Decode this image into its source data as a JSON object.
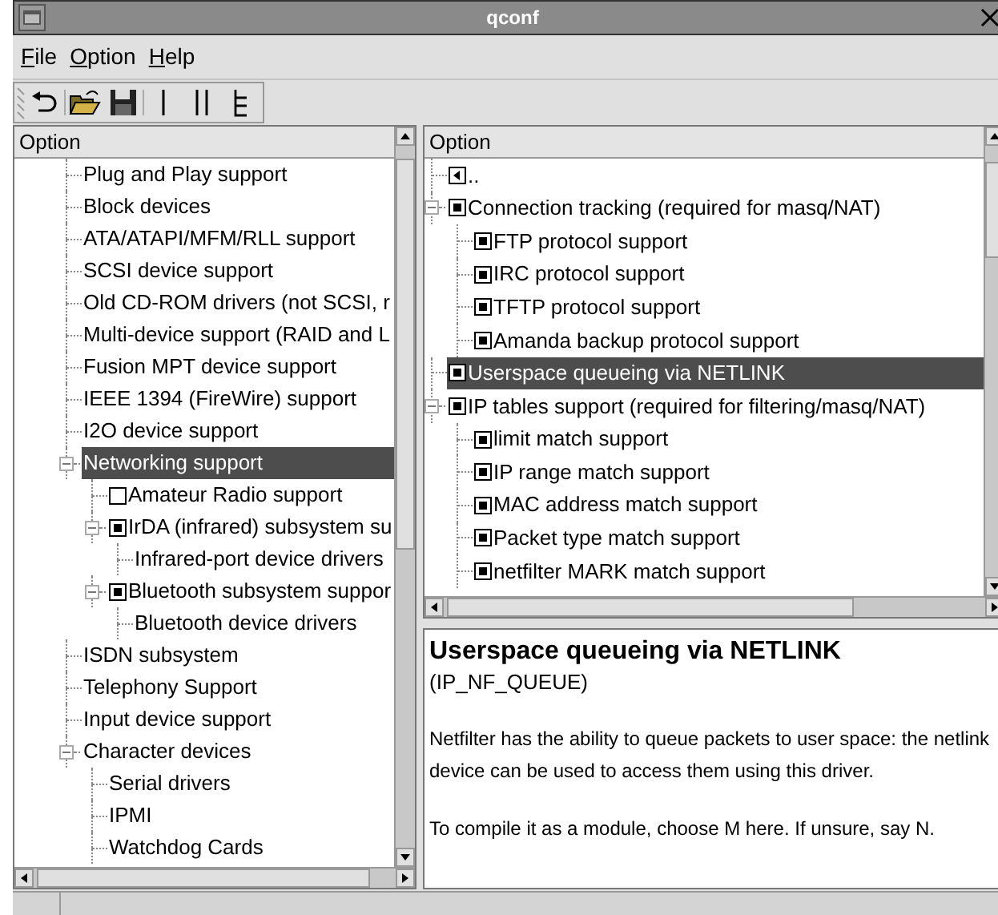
{
  "window": {
    "title": "qconf"
  },
  "menu": [
    {
      "label": "File"
    },
    {
      "label": "Option"
    },
    {
      "label": "Help"
    }
  ],
  "left_tree": {
    "header": "Option",
    "items": [
      {
        "label": "Plug and Play support",
        "kind": "menu",
        "selected": false
      },
      {
        "label": "Block devices",
        "kind": "menu",
        "selected": false
      },
      {
        "label": "ATA/ATAPI/MFM/RLL support",
        "kind": "menu",
        "selected": false
      },
      {
        "label": "SCSI device support",
        "kind": "menu",
        "selected": false
      },
      {
        "label": "Old CD-ROM drivers (not SCSI, r",
        "kind": "menu",
        "selected": false
      },
      {
        "label": "Multi-device support (RAID and L",
        "kind": "menu",
        "selected": false
      },
      {
        "label": "Fusion MPT device support",
        "kind": "menu",
        "selected": false
      },
      {
        "label": "IEEE 1394 (FireWire) support",
        "kind": "menu",
        "selected": false
      },
      {
        "label": "I2O device support",
        "kind": "menu",
        "selected": false
      },
      {
        "label": "Networking support",
        "kind": "menu",
        "selected": true,
        "expanded": true,
        "children": [
          {
            "label": "Amateur Radio support",
            "kind": "checkbox",
            "checked": false,
            "selected": false
          },
          {
            "label": "IrDA (infrared) subsystem su",
            "kind": "checkbox",
            "checked": true,
            "selected": false,
            "expanded": true,
            "children": [
              {
                "label": "Infrared-port device drivers",
                "kind": "menu",
                "selected": false
              }
            ]
          },
          {
            "label": "Bluetooth subsystem suppor",
            "kind": "checkbox",
            "checked": true,
            "selected": false,
            "expanded": true,
            "children": [
              {
                "label": "Bluetooth device drivers",
                "kind": "menu",
                "selected": false
              }
            ]
          }
        ]
      },
      {
        "label": "ISDN subsystem",
        "kind": "menu",
        "selected": false
      },
      {
        "label": "Telephony Support",
        "kind": "menu",
        "selected": false
      },
      {
        "label": "Input device support",
        "kind": "menu",
        "selected": false
      },
      {
        "label": "Character devices",
        "kind": "menu",
        "selected": false,
        "expanded": true,
        "children": [
          {
            "label": "Serial drivers",
            "kind": "menu",
            "selected": false
          },
          {
            "label": "IPMI",
            "kind": "menu",
            "selected": false
          },
          {
            "label": "Watchdog Cards",
            "kind": "menu",
            "selected": false
          }
        ]
      }
    ]
  },
  "right_tree": {
    "header": "Option",
    "items": [
      {
        "label": "..",
        "kind": "back",
        "selected": false
      },
      {
        "label": "Connection tracking (required for masq/NAT)",
        "kind": "checkbox",
        "checked": true,
        "selected": false,
        "expanded": true,
        "children": [
          {
            "label": "FTP protocol support",
            "kind": "checkbox",
            "checked": true,
            "selected": false
          },
          {
            "label": "IRC protocol support",
            "kind": "checkbox",
            "checked": true,
            "selected": false
          },
          {
            "label": "TFTP protocol support",
            "kind": "checkbox",
            "checked": true,
            "selected": false
          },
          {
            "label": "Amanda backup protocol support",
            "kind": "checkbox",
            "checked": true,
            "selected": false
          }
        ]
      },
      {
        "label": "Userspace queueing via NETLINK",
        "kind": "checkbox",
        "checked": true,
        "selected": true
      },
      {
        "label": "IP tables support (required for filtering/masq/NAT)",
        "kind": "checkbox",
        "checked": true,
        "selected": false,
        "expanded": true,
        "children": [
          {
            "label": "limit match support",
            "kind": "checkbox",
            "checked": true,
            "selected": false
          },
          {
            "label": "IP range match support",
            "kind": "checkbox",
            "checked": true,
            "selected": false
          },
          {
            "label": "MAC address match support",
            "kind": "checkbox",
            "checked": true,
            "selected": false
          },
          {
            "label": "Packet type match support",
            "kind": "checkbox",
            "checked": true,
            "selected": false
          },
          {
            "label": "netfilter MARK match support",
            "kind": "checkbox",
            "checked": true,
            "selected": false
          }
        ]
      }
    ]
  },
  "help": {
    "title": "Userspace queueing via NETLINK",
    "symbol": "(IP_NF_QUEUE)",
    "paragraphs": [
      "Netfilter has the ability to queue packets to user space: the netlink device can be used to access them using this driver.",
      "To compile it as a module, choose M here. If unsure, say N."
    ]
  }
}
